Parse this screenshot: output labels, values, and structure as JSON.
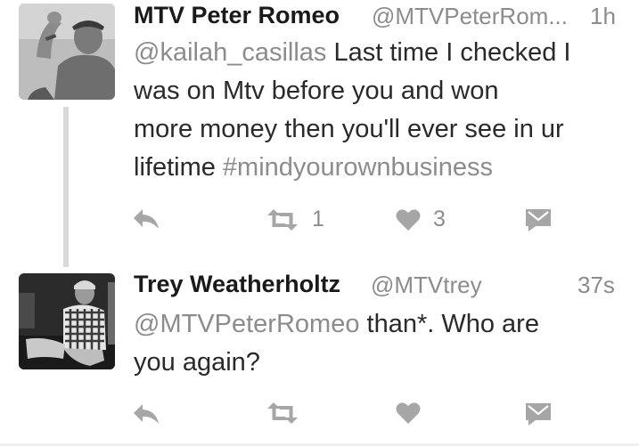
{
  "tweets": [
    {
      "name": "MTV Peter Romeo",
      "handle": "@MTVPeterRom...",
      "time": "1h",
      "mention": "@kailah_casillas",
      "text_line1": " Last time I checked I",
      "text_line2": "was on Mtv before you   and won",
      "text_line3": "more money then you'll ever see in ur",
      "text_line4": "lifetime ",
      "hashtag": "#mindyourownbusiness",
      "retweets": "1",
      "likes": "3"
    },
    {
      "name": "Trey Weatherholtz",
      "handle": "@MTVtrey",
      "time": "37s",
      "mention": "@MTVPeterRomeo",
      "text_line1": " than*. Who are",
      "text_line2": "you again?"
    }
  ],
  "icons": {
    "reply": "reply-icon",
    "retweet": "retweet-icon",
    "like": "heart-icon",
    "dm": "direct-message-icon"
  },
  "colors": {
    "text": "#1a1a1a",
    "muted": "#8c8c8c",
    "icon": "#a6a6a6",
    "thread_line": "#d9d9d9"
  }
}
